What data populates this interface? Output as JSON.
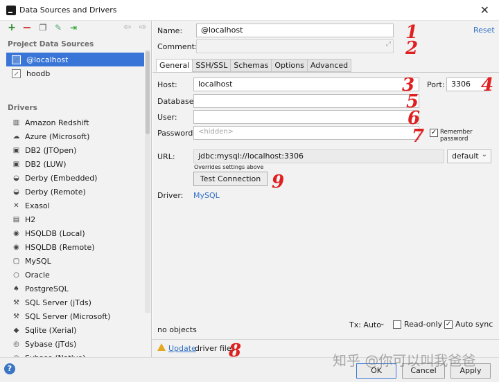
{
  "window": {
    "title": "Data Sources and Drivers"
  },
  "left": {
    "project_title": "Project Data Sources",
    "data_sources": [
      {
        "label": "@localhost",
        "selected": true
      },
      {
        "label": "hoodb",
        "selected": false
      }
    ],
    "drivers_title": "Drivers",
    "drivers": [
      "Amazon Redshift",
      "Azure (Microsoft)",
      "DB2 (JTOpen)",
      "DB2 (LUW)",
      "Derby (Embedded)",
      "Derby (Remote)",
      "Exasol",
      "H2",
      "HSQLDB (Local)",
      "HSQLDB (Remote)",
      "MySQL",
      "Oracle",
      "PostgreSQL",
      "SQL Server (jTds)",
      "SQL Server (Microsoft)",
      "Sqlite (Xerial)",
      "Sybase (jTds)",
      "Sybase (Native)"
    ]
  },
  "form": {
    "name_label": "Name:",
    "name_value": "@localhost",
    "reset": "Reset",
    "comment_label": "Comment:",
    "tabs": [
      "General",
      "SSH/SSL",
      "Schemas",
      "Options",
      "Advanced"
    ],
    "host_label": "Host:",
    "host_value": "localhost",
    "port_label": "Port:",
    "port_value": "3306",
    "database_label": "Database:",
    "user_label": "User:",
    "password_label": "Password:",
    "password_placeholder": "<hidden>",
    "remember_password": "Remember password",
    "url_label": "URL:",
    "url_value": "jdbc:mysql://localhost:3306",
    "url_mode": "default",
    "overrides_note": "Overrides settings above",
    "test_connection": "Test Connection",
    "driver_label": "Driver:",
    "driver_value": "MySQL",
    "status": "no objects",
    "tx_mode": "Tx: Auto",
    "read_only": "Read-only",
    "auto_sync": "Auto sync"
  },
  "bottom": {
    "update_link": "Update",
    "update_rest": "driver files"
  },
  "footer": {
    "help": "?",
    "ok": "OK",
    "cancel": "Cancel",
    "apply": "Apply"
  },
  "annotations": [
    "1",
    "2",
    "3",
    "4",
    "5",
    "6",
    "7",
    "8",
    "9"
  ],
  "watermark": "知乎 @你可以叫我爸爸",
  "colors": {
    "selection": "#3875d7",
    "link": "#2f6fc4",
    "annotation": "#e02020"
  }
}
